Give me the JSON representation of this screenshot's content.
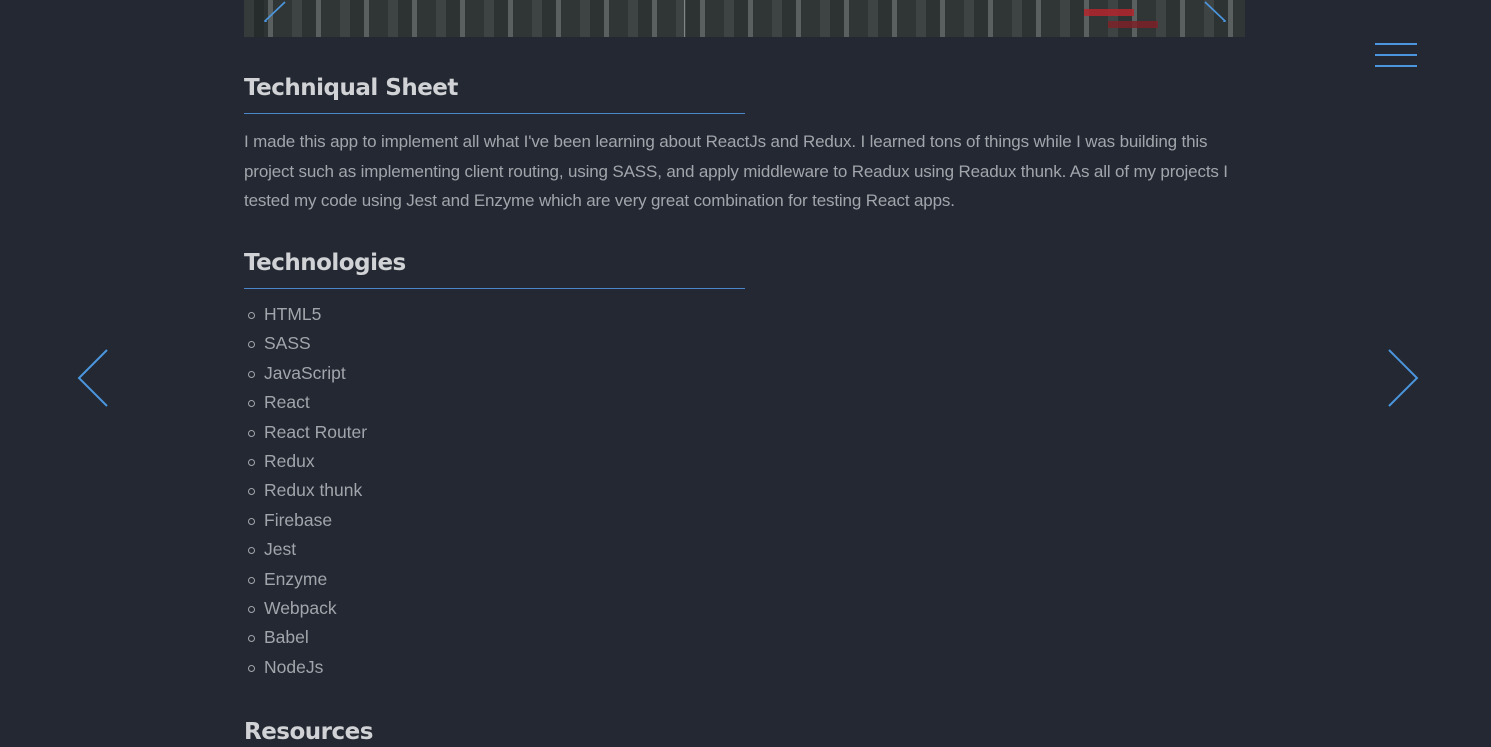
{
  "sections": {
    "technical_sheet": {
      "title": "Techniqual Sheet",
      "description": "I made this app to implement all what I've been learning about ReactJs and Redux. I learned tons of things while I was building this project such as implementing client routing, using SASS, and apply middleware to Readux using Readux thunk. As all of my projects I tested my code using Jest and Enzyme which are very great combination for testing React apps."
    },
    "technologies": {
      "title": "Technologies",
      "items": [
        "HTML5",
        "SASS",
        "JavaScript",
        "React",
        "React Router",
        "Redux",
        "Redux thunk",
        "Firebase",
        "Jest",
        "Enzyme",
        "Webpack",
        "Babel",
        "NodeJs"
      ]
    },
    "resources": {
      "title": "Resources"
    }
  },
  "icons": {
    "menu": "hamburger-menu-icon",
    "previous": "chevron-left-icon",
    "next": "chevron-right-icon"
  },
  "colors": {
    "background": "#232832",
    "accent": "#4b96de",
    "heading": "#d0d2d5",
    "body_text": "#a2a5ab"
  }
}
